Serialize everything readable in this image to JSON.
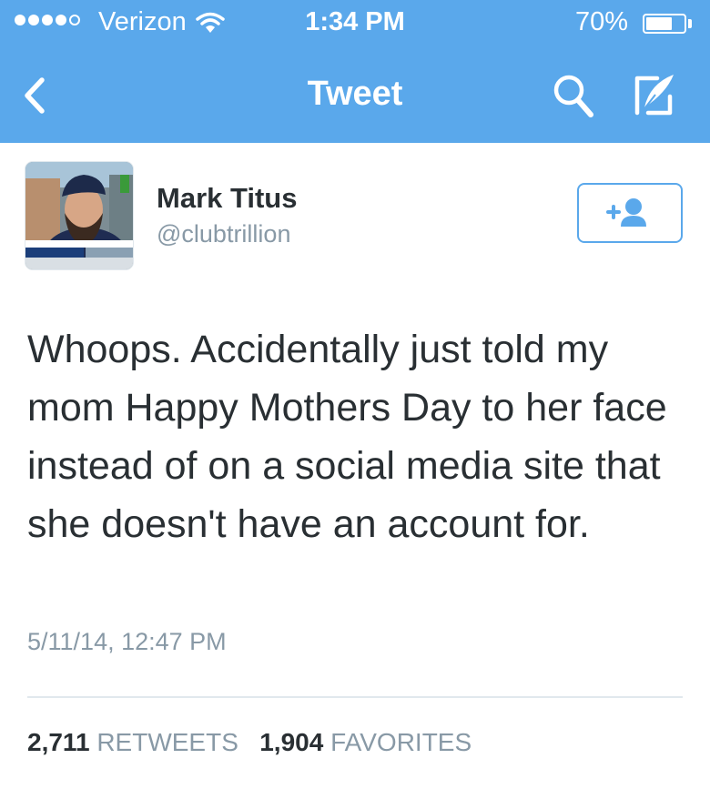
{
  "status_bar": {
    "carrier": "Verizon",
    "time": "1:34 PM",
    "battery_percent": "70%",
    "battery_level": 0.7,
    "signal_bars_filled": 4,
    "signal_bars_total": 5
  },
  "nav": {
    "title": "Tweet",
    "back_icon": "chevron-left-icon",
    "search_icon": "search-icon",
    "compose_icon": "compose-icon"
  },
  "tweet": {
    "author_name": "Mark Titus",
    "author_handle": "@clubtrillion",
    "text": "Whoops. Accidentally just told my mom Happy Mothers Day to her face instead of on a social media site that she doesn't have an account for.",
    "timestamp": "5/11/14, 12:47 PM",
    "follow_icon": "follow-user-icon"
  },
  "stats": {
    "retweets_count": "2,711",
    "retweets_label": "RETWEETS",
    "favorites_count": "1,904",
    "favorites_label": "FAVORITES"
  },
  "colors": {
    "accent": "#5aa8eb",
    "text": "#292f33",
    "muted": "#8899a6"
  }
}
